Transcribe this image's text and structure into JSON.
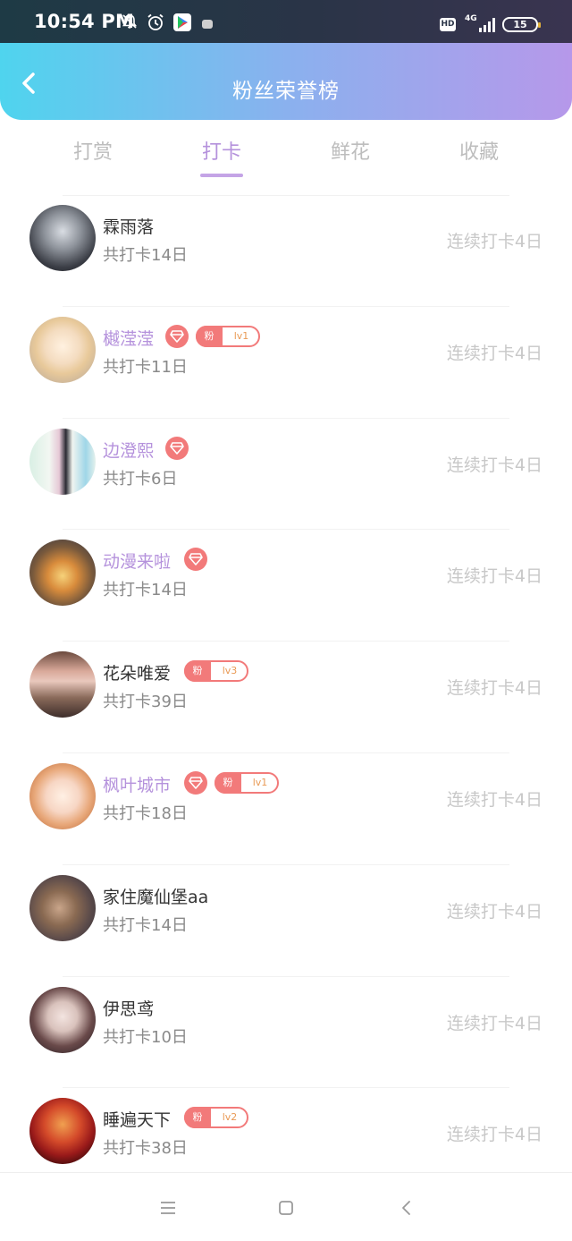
{
  "status_bar": {
    "time": "10:54 PM",
    "icons": [
      "bell-muted-icon",
      "alarm-icon",
      "play-store-icon",
      "app-icon",
      "hd-icon",
      "signal-icon"
    ],
    "hd": "HD",
    "network": "4G",
    "battery": "15"
  },
  "header": {
    "title": "粉丝荣誉榜",
    "back_icon": "chevron-left-icon",
    "gradient": [
      "#4fd4ee",
      "#b698ea"
    ]
  },
  "tabs": [
    {
      "label": "打赏",
      "active": false
    },
    {
      "label": "打卡",
      "active": true
    },
    {
      "label": "鲜花",
      "active": false
    },
    {
      "label": "收藏",
      "active": false
    }
  ],
  "accent_color": "#b592dc",
  "badge_color": "#f27a7a",
  "items": [
    {
      "name": "霖雨落",
      "vip": false,
      "diamond": false,
      "fan_level": "",
      "total": "共打卡14日",
      "streak": "连续打卡4日"
    },
    {
      "name": "樾滢滢",
      "vip": true,
      "diamond": true,
      "fan_label": "粉",
      "fan_level": "lv1",
      "total": "共打卡11日",
      "streak": "连续打卡4日"
    },
    {
      "name": "边澄熙",
      "vip": true,
      "diamond": true,
      "fan_level": "",
      "total": "共打卡6日",
      "streak": "连续打卡4日"
    },
    {
      "name": "动漫来啦",
      "vip": true,
      "diamond": true,
      "fan_level": "",
      "total": "共打卡14日",
      "streak": "连续打卡4日"
    },
    {
      "name": "花朵唯爱",
      "vip": false,
      "diamond": false,
      "fan_label": "粉",
      "fan_level": "lv3",
      "total": "共打卡39日",
      "streak": "连续打卡4日"
    },
    {
      "name": "枫叶城市",
      "vip": true,
      "diamond": true,
      "fan_label": "粉",
      "fan_level": "lv1",
      "total": "共打卡18日",
      "streak": "连续打卡4日"
    },
    {
      "name": "家住魔仙堡aa",
      "vip": false,
      "diamond": false,
      "fan_level": "",
      "total": "共打卡14日",
      "streak": "连续打卡4日"
    },
    {
      "name": "伊思鸢",
      "vip": false,
      "diamond": false,
      "fan_level": "",
      "total": "共打卡10日",
      "streak": "连续打卡4日"
    },
    {
      "name": "睡遍天下",
      "vip": false,
      "diamond": false,
      "fan_label": "粉",
      "fan_level": "lv2",
      "total": "共打卡38日",
      "streak": "连续打卡4日"
    }
  ],
  "nav_bar": {
    "icons": [
      "menu-icon",
      "home-icon",
      "back-icon"
    ]
  }
}
